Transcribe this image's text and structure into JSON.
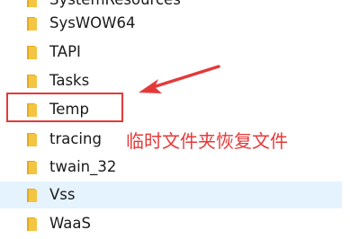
{
  "folders": [
    {
      "name": "SystemResources",
      "selected": false
    },
    {
      "name": "SysWOW64",
      "selected": false
    },
    {
      "name": "TAPI",
      "selected": false
    },
    {
      "name": "Tasks",
      "selected": false
    },
    {
      "name": "Temp",
      "selected": false,
      "highlighted": true
    },
    {
      "name": "tracing",
      "selected": false
    },
    {
      "name": "twain_32",
      "selected": false
    },
    {
      "name": "Vss",
      "selected": true
    },
    {
      "name": "WaaS",
      "selected": false
    }
  ],
  "annotation": {
    "text": "临时文件夹恢复文件"
  },
  "colors": {
    "folder_body": "#f4c542",
    "folder_back": "#e2ab1f",
    "annotation": "#e53939",
    "selection": "#e5f3ff"
  },
  "icons": {
    "folder": "folder-icon",
    "arrow": "red-arrow-icon"
  }
}
